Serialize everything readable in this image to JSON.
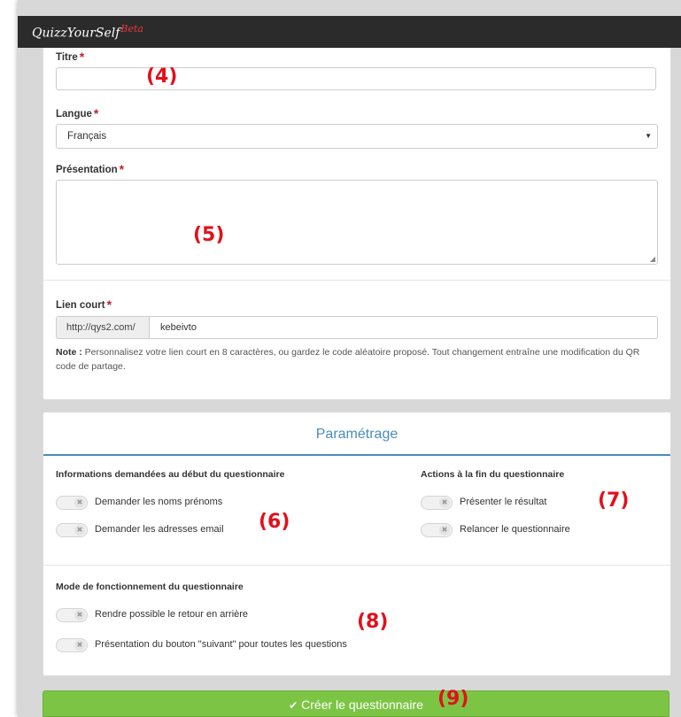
{
  "app": {
    "logo": "QuizzYourSelf",
    "logo_badge": "Beta"
  },
  "form": {
    "title_label": "Titre",
    "title_value": "",
    "language_label": "Langue",
    "language_value": "Français",
    "presentation_label": "Présentation",
    "presentation_value": "",
    "short_link_label": "Lien court",
    "short_link_prefix": "http://qys2.com/",
    "short_link_value": "kebeivto",
    "note_label": "Note :",
    "note_text": "Personnalisez votre lien court en 8 caractères, ou gardez le code aléatoire proposé. Tout changement entraîne une modification du QR code de partage.",
    "required_mark": "*"
  },
  "settings": {
    "title": "Paramétrage",
    "info_group_label": "Informations demandées au début du questionnaire",
    "info_options": [
      {
        "label": "Demander les noms prénoms",
        "on": false
      },
      {
        "label": "Demander les adresses email",
        "on": false
      }
    ],
    "end_group_label": "Actions à la fin du questionnaire",
    "end_options": [
      {
        "label": "Présenter le résultat",
        "on": false
      },
      {
        "label": "Relancer le questionnaire",
        "on": false
      }
    ],
    "mode_group_label": "Mode de fonctionnement du questionnaire",
    "mode_options": [
      {
        "label": "Rendre possible le retour en arrière",
        "on": false
      },
      {
        "label": "Présentation du bouton \"suivant\" pour toutes les questions",
        "on": false
      }
    ],
    "toggle_off_glyph": "✖"
  },
  "create_button": {
    "label": "Créer le questionnaire",
    "icon": "check-icon"
  },
  "annotations": [
    "(4)",
    "(5)",
    "(6)",
    "(7)",
    "(8)",
    "(9)"
  ],
  "colors": {
    "accent": "#4a8cbd",
    "required": "#c41e2b",
    "button": "#7cc544",
    "annotation": "#e2101c"
  }
}
